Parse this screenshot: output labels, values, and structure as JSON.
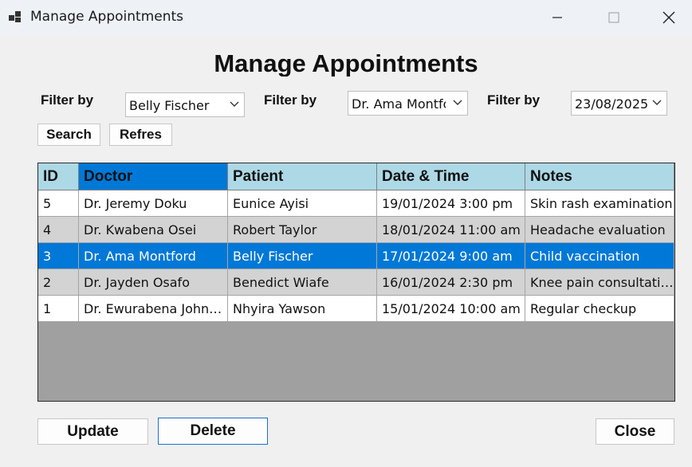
{
  "window": {
    "title": "Manage Appointments",
    "icons": [
      "app-icon",
      "minimize-icon",
      "maximize-icon",
      "close-icon"
    ]
  },
  "form": {
    "heading": "Manage Appointments",
    "filters": [
      {
        "label": "Filter by",
        "value": "Belly Fischer"
      },
      {
        "label": "Filter by",
        "value": "Dr. Ama Montford"
      },
      {
        "label": "Filter by",
        "value": "23/08/2025"
      }
    ],
    "search_label": "Search",
    "refresh_label": "Refres",
    "update_label": "Update",
    "delete_label": "Delete",
    "close_label": "Close"
  },
  "table": {
    "columns": [
      "ID",
      "Doctor",
      "Patient",
      "Date & Time",
      "Notes"
    ],
    "rows": [
      [
        "5",
        "Dr. Jeremy Doku",
        "Eunice Ayisi",
        "19/01/2024 3:00 pm",
        "Skin rash examination"
      ],
      [
        "4",
        "Dr. Kwabena Osei",
        "Robert Taylor",
        "18/01/2024 11:00 am",
        "Headache evaluation"
      ],
      [
        "3",
        "Dr. Ama Montford",
        "Belly Fischer",
        "17/01/2024 9:00 am",
        "Child vaccination"
      ],
      [
        "2",
        "Dr. Jayden Osafo",
        "Benedict Wiafe",
        "16/01/2024 2:30 pm",
        "Knee pain consultati…"
      ],
      [
        "1",
        "Dr. Ewurabena John…",
        "Nhyira Yawson",
        "15/01/2024 10:00 am",
        "Regular checkup"
      ]
    ],
    "selected_row_id": "3"
  },
  "colors": {
    "header_bg": "#add8e6",
    "selection": "#0078d7",
    "alt_row": "#d3d3d3",
    "empty_area": "#a0a0a0"
  }
}
